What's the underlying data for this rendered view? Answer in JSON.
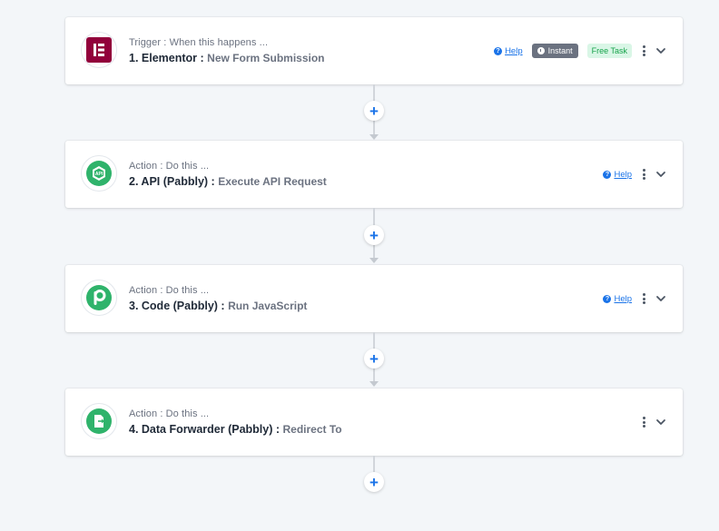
{
  "steps": [
    {
      "subtitle": "Trigger : When this happens ...",
      "title": "1. Elementor :",
      "event": "New Form Submission",
      "help": "Help",
      "instant": "Instant",
      "free_task": "Free Task",
      "icon": "elementor-icon",
      "icon_color": "#92003b"
    },
    {
      "subtitle": "Action : Do this ...",
      "title": "2. API (Pabbly) :",
      "event": "Execute API Request",
      "help": "Help",
      "icon": "api-icon",
      "icon_color": "#2fb36b"
    },
    {
      "subtitle": "Action : Do this ...",
      "title": "3. Code (Pabbly) :",
      "event": "Run JavaScript",
      "help": "Help",
      "icon": "pabbly-code-icon",
      "icon_color": "#2fb36b"
    },
    {
      "subtitle": "Action : Do this ...",
      "title": "4. Data Forwarder (Pabbly) :",
      "event": "Redirect To",
      "icon": "data-forwarder-icon",
      "icon_color": "#2fb36b"
    }
  ],
  "add_step_label": "+",
  "colors": {
    "accent": "#1a73e8",
    "background": "#f3f6f9",
    "instant_badge": "#6b7280",
    "free_badge_bg": "#d9f6e6",
    "free_badge_text": "#16a34a"
  }
}
